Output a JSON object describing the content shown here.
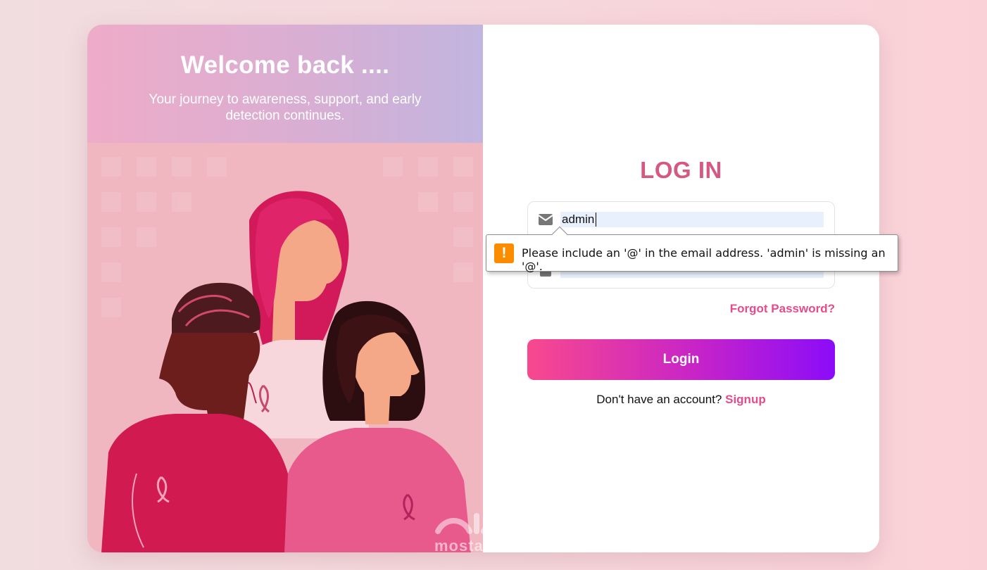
{
  "hero": {
    "title": "Welcome back ....",
    "subtitle": "Your journey to awareness, support, and early detection continues."
  },
  "watermark": "mostaql.com",
  "login_form": {
    "title": "LOG IN",
    "email_value": "admin",
    "email_icon": "envelope-icon",
    "password_value": "",
    "password_icon": "lock-icon",
    "forgot_label": "Forgot Password?",
    "submit_label": "Login",
    "signup_prompt": "Don't have an account?",
    "signup_label": "Signup"
  },
  "validation_tooltip": {
    "icon": "warning-icon",
    "message": "Please include an '@' in the email address. 'admin' is missing an '@'."
  },
  "colors": {
    "accent": "#d6577f",
    "link": "#e64b8b",
    "button_start": "#f8498e",
    "button_end": "#8b0cf9",
    "warning": "#fb8c00"
  }
}
